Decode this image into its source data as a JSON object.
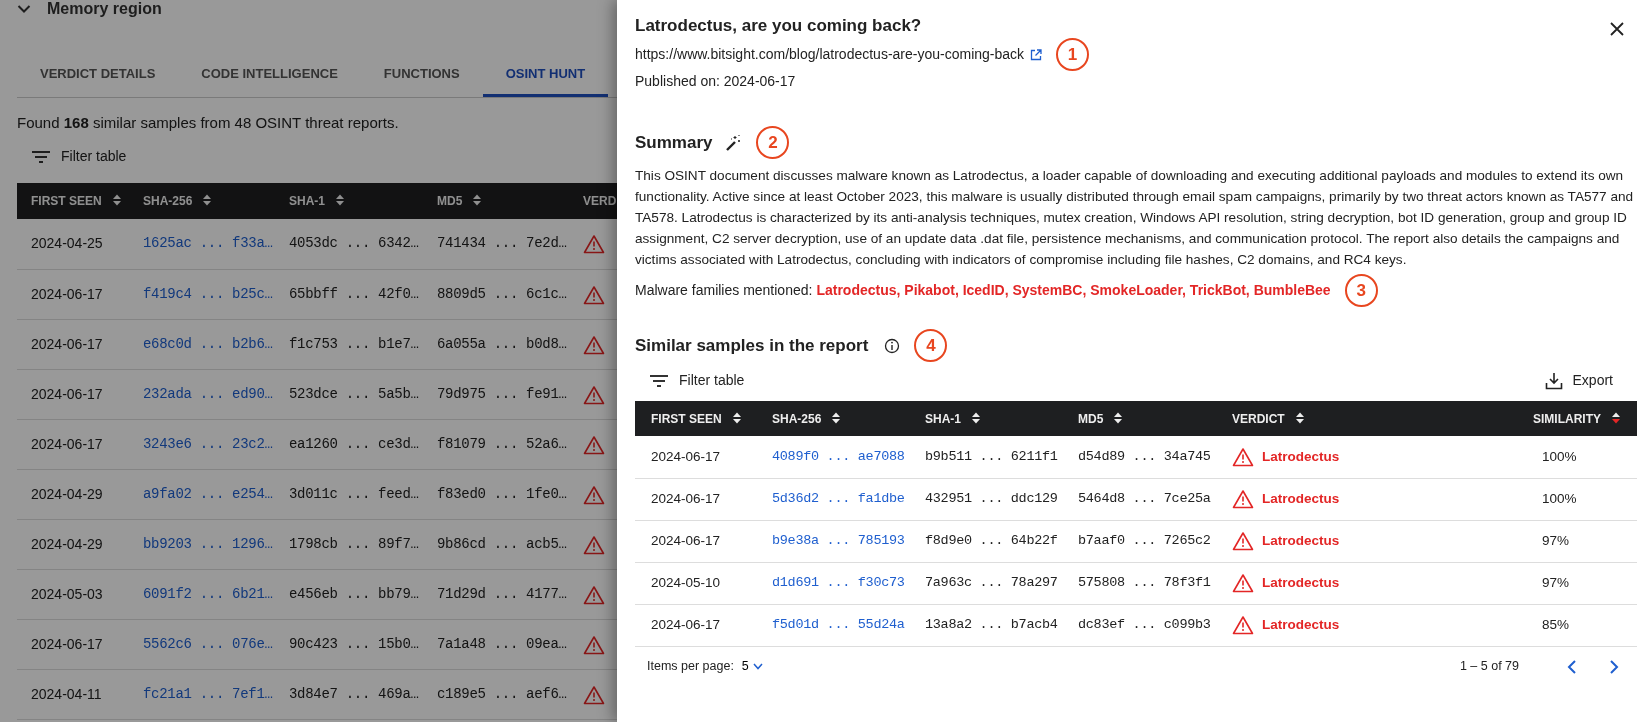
{
  "background_page": {
    "section_header": "Memory region",
    "tabs": [
      {
        "label": "VERDICT DETAILS",
        "selected": false
      },
      {
        "label": "CODE INTELLIGENCE",
        "selected": false
      },
      {
        "label": "FUNCTIONS",
        "selected": false
      },
      {
        "label": "OSINT HUNT",
        "selected": true
      }
    ],
    "result_summary": "Found **168** similar samples from 48 OSINT threat reports.",
    "filter_label": "Filter table",
    "table": {
      "columns": [
        "FIRST SEEN",
        "SHA-256",
        "SHA-1",
        "MD5",
        "VERD"
      ],
      "rows": [
        {
          "first_seen": "2024-04-25",
          "sha256": "1625ac ... f33a…",
          "sha1": "4053dc ... 6342…",
          "md5": "741434 ... 7e2d…"
        },
        {
          "first_seen": "2024-06-17",
          "sha256": "f419c4 ... b25c…",
          "sha1": "65bbff ... 42f0…",
          "md5": "8809d5 ... 6c1c…"
        },
        {
          "first_seen": "2024-06-17",
          "sha256": "e68c0d ... b2b6…",
          "sha1": "f1c753 ... b1e7…",
          "md5": "6a055a ... b0d8…"
        },
        {
          "first_seen": "2024-06-17",
          "sha256": "232ada ... ed90…",
          "sha1": "523dce ... 5a5b…",
          "md5": "79d975 ... fe91…"
        },
        {
          "first_seen": "2024-06-17",
          "sha256": "3243e6 ... 23c2…",
          "sha1": "ea1260 ... ce3d…",
          "md5": "f81079 ... 52a6…"
        },
        {
          "first_seen": "2024-04-29",
          "sha256": "a9fa02 ... e254…",
          "sha1": "3d011c ... feed…",
          "md5": "f83ed0 ... 1fe0…"
        },
        {
          "first_seen": "2024-04-29",
          "sha256": "bb9203 ... 1296…",
          "sha1": "1798cb ... 89f7…",
          "md5": "9b86cd ... acb5…"
        },
        {
          "first_seen": "2024-05-03",
          "sha256": "6091f2 ... 6b21…",
          "sha1": "e456eb ... bb79…",
          "md5": "71d29d ... 4177…"
        },
        {
          "first_seen": "2024-06-17",
          "sha256": "5562c6 ... 076e…",
          "sha1": "90c423 ... 15b0…",
          "md5": "7a1a48 ... 09ea…"
        },
        {
          "first_seen": "2024-04-11",
          "sha256": "fc21a1 ... 7ef1…",
          "sha1": "3d84e7 ... 469a…",
          "md5": "c189e5 ... aef6…"
        }
      ]
    }
  },
  "drawer": {
    "title": "Latrodectus, are you coming back?",
    "url": "https://www.bitsight.com/blog/latrodectus-are-you-coming-back",
    "url_marker": "1",
    "published": "Published on: 2024-06-17",
    "summary_heading": "Summary",
    "summary_marker": "2",
    "summary_text": "This OSINT document discusses malware known as Latrodectus, a loader capable of downloading and executing additional payloads and modules to extend its own functionality. Active since at least October 2023, this malware is usually distributed through email spam campaigns, primarily by two threat actors known as TA577 and TA578. Latrodectus is characterized by its anti-analysis techniques, mutex creation, Windows API resolution, string decryption, bot ID generation, group and group ID assignment, C2 server decryption, use of an update data .dat file, persistence mechanisms, and communication protocol. The report also details the campaigns and victims associated with Latrodectus, concluding with indicators of compromise including file hashes, C2 domains, and RC4 keys.",
    "families_label": "Malware families mentioned:",
    "families": "Latrodectus, Pikabot, IcedID, SystemBC, SmokeLoader, TrickBot, BumbleBee",
    "families_marker": "3",
    "samples_heading": "Similar samples in the report",
    "samples_marker": "4",
    "filter_label": "Filter table",
    "export_label": "Export",
    "table": {
      "columns": [
        {
          "label": "FIRST SEEN",
          "sorted": false
        },
        {
          "label": "SHA-256",
          "sorted": false
        },
        {
          "label": "SHA-1",
          "sorted": false
        },
        {
          "label": "MD5",
          "sorted": false
        },
        {
          "label": "VERDICT",
          "sorted": false
        },
        {
          "label": "SIMILARITY",
          "sorted": true
        }
      ],
      "rows": [
        {
          "first_seen": "2024-06-17",
          "sha256": "4089f0 ... ae7088",
          "sha1": "b9b511 ... 6211f1",
          "md5": "d54d89 ... 34a745",
          "verdict": "Latrodectus",
          "similarity": "100%"
        },
        {
          "first_seen": "2024-06-17",
          "sha256": "5d36d2 ... fa1dbe",
          "sha1": "432951 ... ddc129",
          "md5": "5464d8 ... 7ce25a",
          "verdict": "Latrodectus",
          "similarity": "100%"
        },
        {
          "first_seen": "2024-06-17",
          "sha256": "b9e38a ... 785193",
          "sha1": "f8d9e0 ... 64b22f",
          "md5": "b7aaf0 ... 7265c2",
          "verdict": "Latrodectus",
          "similarity": "97%"
        },
        {
          "first_seen": "2024-05-10",
          "sha256": "d1d691 ... f30c73",
          "sha1": "7a963c ... 78a297",
          "md5": "575808 ... 78f3f1",
          "verdict": "Latrodectus",
          "similarity": "97%"
        },
        {
          "first_seen": "2024-06-17",
          "sha256": "f5d01d ... 55d24a",
          "sha1": "13a8a2 ... b7acb4",
          "md5": "dc83ef ... c099b3",
          "verdict": "Latrodectus",
          "similarity": "85%"
        }
      ]
    },
    "pagination": {
      "items_label": "Items per page:",
      "page_size": "5",
      "range": "1 – 5 of 79"
    }
  }
}
